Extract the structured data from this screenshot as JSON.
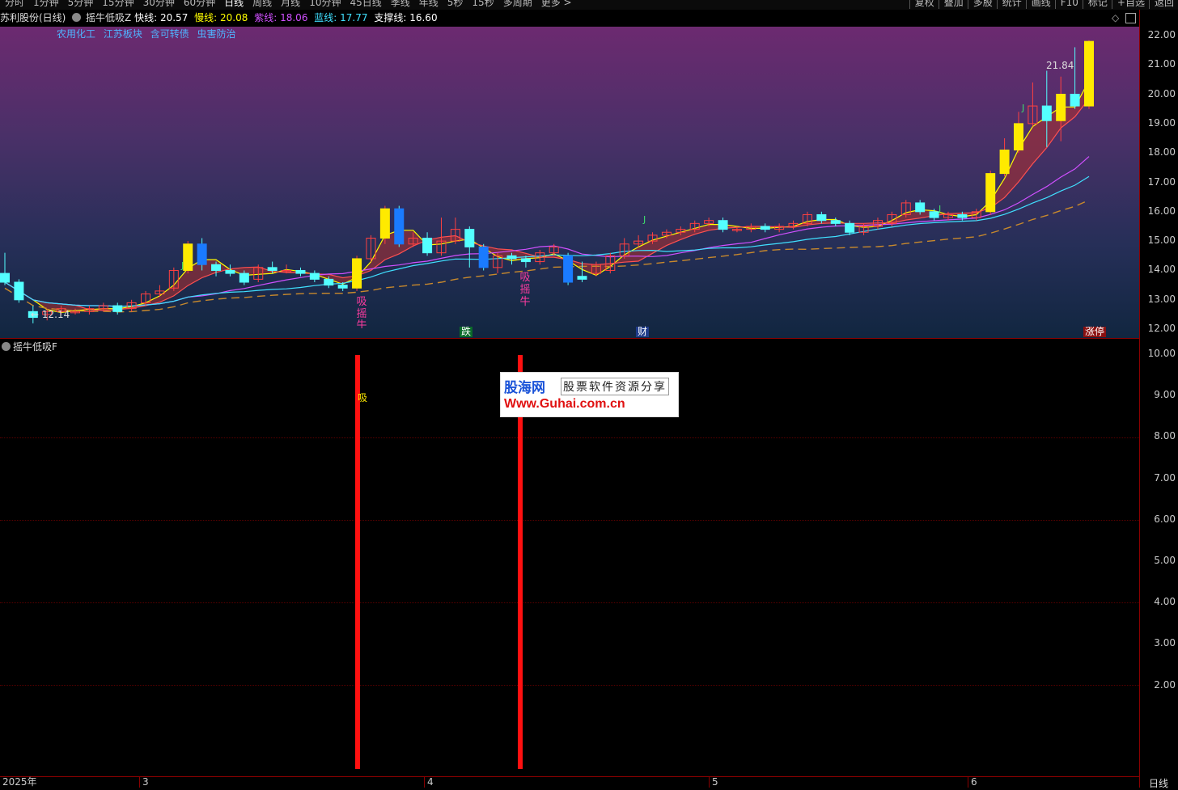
{
  "toolbar": {
    "periods": [
      "分时",
      "1分钟",
      "5分钟",
      "15分钟",
      "30分钟",
      "60分钟",
      "日线",
      "周线",
      "月线",
      "10分钟",
      "45日线",
      "季线",
      "年线",
      "5秒",
      "15秒",
      "多周期",
      "更多 >"
    ],
    "active_period": "日线",
    "right_buttons": [
      "复权",
      "叠加",
      "多股",
      "统计",
      "画线",
      "F10",
      "标记",
      "+自选",
      "返回"
    ]
  },
  "info": {
    "stock": "苏利股份(日线)",
    "indicator": "摇牛低吸Z",
    "fast_label": "快线:",
    "fast_value": "20.57",
    "slow_label": "慢线:",
    "slow_value": "20.08",
    "purple_label": "紫线:",
    "purple_value": "18.06",
    "blue_label": "蓝线:",
    "blue_value": "17.77",
    "support_label": "支撑线:",
    "support_value": "16.60",
    "colors": {
      "fast": "#ffffff",
      "slow": "#ffff00",
      "purple": "#d050ff",
      "blue": "#40e0ff",
      "support": "#ffffff"
    }
  },
  "concepts": [
    "农用化工",
    "江苏板块",
    "含可转债",
    "虫害防治"
  ],
  "main_chart": {
    "y_ticks": [
      "22.00",
      "21.00",
      "20.00",
      "19.00",
      "18.00",
      "17.00",
      "16.00",
      "15.00",
      "14.00",
      "13.00",
      "12.00"
    ],
    "high_label": "21.84",
    "low_label": "12.14",
    "markers": {
      "die": "跌",
      "cai": "财",
      "zhangting": "涨停"
    },
    "signal_text_1": [
      "吸",
      "摇",
      "牛"
    ],
    "signal_text_2": [
      "吸",
      "摇",
      "牛"
    ],
    "j_marks": [
      "J",
      "J",
      "J",
      "J"
    ]
  },
  "sub_chart": {
    "title": "摇牛低吸F",
    "y_ticks": [
      "10.00",
      "9.00",
      "8.00",
      "7.00",
      "6.00",
      "5.00",
      "4.00",
      "3.00",
      "2.00"
    ],
    "signal_label": "吸"
  },
  "watermark": {
    "logo": "股海网",
    "slogan": "股票软件资源分享",
    "url": "Www.Guhai.com.cn"
  },
  "time_axis": {
    "labels": [
      "2025年",
      "3",
      "4",
      "5",
      "6"
    ],
    "period": "日线"
  },
  "chart_data": {
    "type": "candlestick",
    "ylim": [
      11.7,
      22.3
    ],
    "candles": [
      [
        13.9,
        13.6,
        14.6,
        13.5
      ],
      [
        13.6,
        13.0,
        13.7,
        12.9
      ],
      [
        12.6,
        12.4,
        12.8,
        12.2
      ],
      [
        12.5,
        12.6,
        12.7,
        12.3
      ],
      [
        12.6,
        12.7,
        12.8,
        12.5
      ],
      [
        12.6,
        12.6,
        12.7,
        12.5
      ],
      [
        12.6,
        12.7,
        12.8,
        12.5
      ],
      [
        12.7,
        12.8,
        12.9,
        12.6
      ],
      [
        12.8,
        12.6,
        12.9,
        12.5
      ],
      [
        12.7,
        12.9,
        13.0,
        12.6
      ],
      [
        12.9,
        13.2,
        13.3,
        12.8
      ],
      [
        13.2,
        13.3,
        13.5,
        13.1
      ],
      [
        13.4,
        14.0,
        14.1,
        13.3
      ],
      [
        14.0,
        14.9,
        15.0,
        13.9
      ],
      [
        14.9,
        14.2,
        15.1,
        14.0
      ],
      [
        14.2,
        14.0,
        14.3,
        13.8
      ],
      [
        14.0,
        13.9,
        14.2,
        13.8
      ],
      [
        13.9,
        13.6,
        14.0,
        13.5
      ],
      [
        13.7,
        14.1,
        14.2,
        13.6
      ],
      [
        14.1,
        14.0,
        14.3,
        13.9
      ],
      [
        14.0,
        14.0,
        14.2,
        13.9
      ],
      [
        14.0,
        13.9,
        14.1,
        13.8
      ],
      [
        13.9,
        13.7,
        14.0,
        13.6
      ],
      [
        13.7,
        13.5,
        13.8,
        13.4
      ],
      [
        13.5,
        13.4,
        13.6,
        13.3
      ],
      [
        13.4,
        14.4,
        14.5,
        13.3
      ],
      [
        14.4,
        15.1,
        15.2,
        14.3
      ],
      [
        15.1,
        16.1,
        16.2,
        14.9
      ],
      [
        16.1,
        14.9,
        16.2,
        14.8
      ],
      [
        14.9,
        15.1,
        15.3,
        14.8
      ],
      [
        15.1,
        14.6,
        15.3,
        14.5
      ],
      [
        14.6,
        15.0,
        15.8,
        14.5
      ],
      [
        15.0,
        15.4,
        15.8,
        14.9
      ],
      [
        15.4,
        14.8,
        15.5,
        14.1
      ],
      [
        14.8,
        14.1,
        14.9,
        14.0
      ],
      [
        14.1,
        14.5,
        14.6,
        13.9
      ],
      [
        14.5,
        14.4,
        14.6,
        14.2
      ],
      [
        14.4,
        14.3,
        14.5,
        14.1
      ],
      [
        14.3,
        14.6,
        14.7,
        14.2
      ],
      [
        14.6,
        14.8,
        14.9,
        14.5
      ],
      [
        14.5,
        13.6,
        14.6,
        13.5
      ],
      [
        13.8,
        13.7,
        14.3,
        13.6
      ],
      [
        13.9,
        14.2,
        14.3,
        13.8
      ],
      [
        14.0,
        14.5,
        14.6,
        13.9
      ],
      [
        14.5,
        14.9,
        15.1,
        14.4
      ],
      [
        14.9,
        15.0,
        15.2,
        14.8
      ],
      [
        15.0,
        15.2,
        15.3,
        14.9
      ],
      [
        15.2,
        15.3,
        15.4,
        15.1
      ],
      [
        15.3,
        15.4,
        15.5,
        15.2
      ],
      [
        15.4,
        15.6,
        15.7,
        15.3
      ],
      [
        15.6,
        15.7,
        15.8,
        15.5
      ],
      [
        15.7,
        15.4,
        15.8,
        15.3
      ],
      [
        15.4,
        15.4,
        15.5,
        15.3
      ],
      [
        15.4,
        15.5,
        15.6,
        15.3
      ],
      [
        15.5,
        15.4,
        15.6,
        15.3
      ],
      [
        15.4,
        15.5,
        15.6,
        15.3
      ],
      [
        15.5,
        15.6,
        15.7,
        15.4
      ],
      [
        15.6,
        15.9,
        16.0,
        15.5
      ],
      [
        15.9,
        15.7,
        16.0,
        15.6
      ],
      [
        15.7,
        15.6,
        15.8,
        15.5
      ],
      [
        15.6,
        15.3,
        15.7,
        15.2
      ],
      [
        15.3,
        15.5,
        15.6,
        15.2
      ],
      [
        15.5,
        15.7,
        15.8,
        15.4
      ],
      [
        15.6,
        15.9,
        16.0,
        15.5
      ],
      [
        15.9,
        16.3,
        16.4,
        15.8
      ],
      [
        16.3,
        16.0,
        16.4,
        15.9
      ],
      [
        16.0,
        15.8,
        16.1,
        15.7
      ],
      [
        15.8,
        15.9,
        16.0,
        15.7
      ],
      [
        15.9,
        15.8,
        16.0,
        15.7
      ],
      [
        15.8,
        16.0,
        16.1,
        15.7
      ],
      [
        16.0,
        17.3,
        17.4,
        15.9
      ],
      [
        17.3,
        18.1,
        18.5,
        17.2
      ],
      [
        18.1,
        19.0,
        19.4,
        18.0
      ],
      [
        19.0,
        19.6,
        20.4,
        18.9
      ],
      [
        19.6,
        19.1,
        20.8,
        18.2
      ],
      [
        19.1,
        20.0,
        20.6,
        18.4
      ],
      [
        20.0,
        19.6,
        21.6,
        19.5
      ],
      [
        19.6,
        21.8,
        21.84,
        19.5
      ]
    ]
  }
}
